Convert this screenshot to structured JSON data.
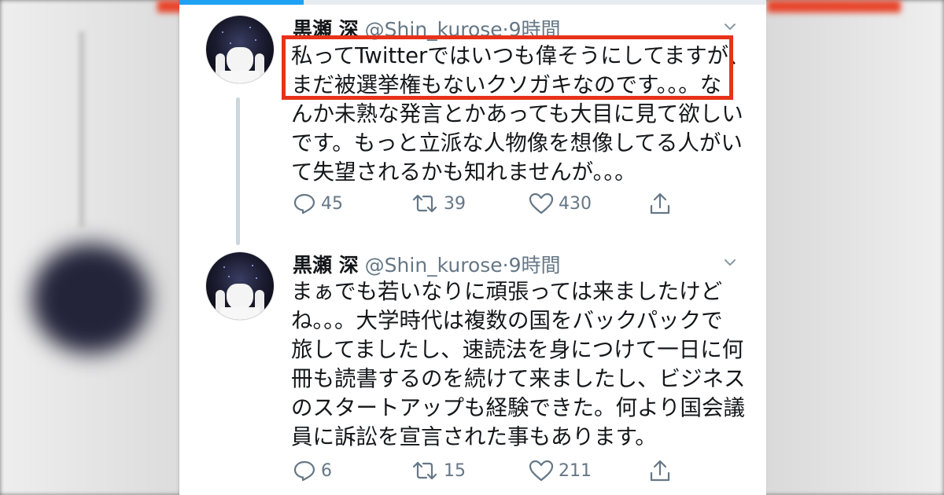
{
  "tweets": [
    {
      "name": "黒瀬 深",
      "handle": "@Shin_kurose",
      "time": "9時間",
      "lines": [
        "私ってTwitterではいつも偉そうにしてますが、",
        "まだ被選挙権もないクソガキなのです。。。な",
        "んか未熟な発言とかあっても大目に見て欲しい",
        "です。もっと立派な人物像を想像してる人がい",
        "て失望されるかも知れませんが。。。"
      ],
      "actions": {
        "replies": "45",
        "retweets": "39",
        "likes": "430"
      }
    },
    {
      "name": "黒瀬 深",
      "handle": "@Shin_kurose",
      "time": "9時間",
      "lines": [
        "まぁでも若いなりに頑張っては来ましたけど",
        "ね。。。大学時代は複数の国をバックパックで",
        "旅してましたし、速読法を身につけて一日に何",
        "冊も読書するのを続けて来ましたし、ビジネス",
        "のスタートアップも経験できた。何より国会議",
        "員に訴訟を宣言された事もあります。"
      ],
      "actions": {
        "replies": "6",
        "retweets": "15",
        "likes": "211"
      }
    }
  ],
  "colors": {
    "highlight": "#e8321a",
    "accent": "#1da1f2",
    "meta": "#657786",
    "text": "#14171a"
  },
  "icons": [
    "reply-icon",
    "retweet-icon",
    "like-icon",
    "share-icon",
    "chevron-down-icon"
  ]
}
